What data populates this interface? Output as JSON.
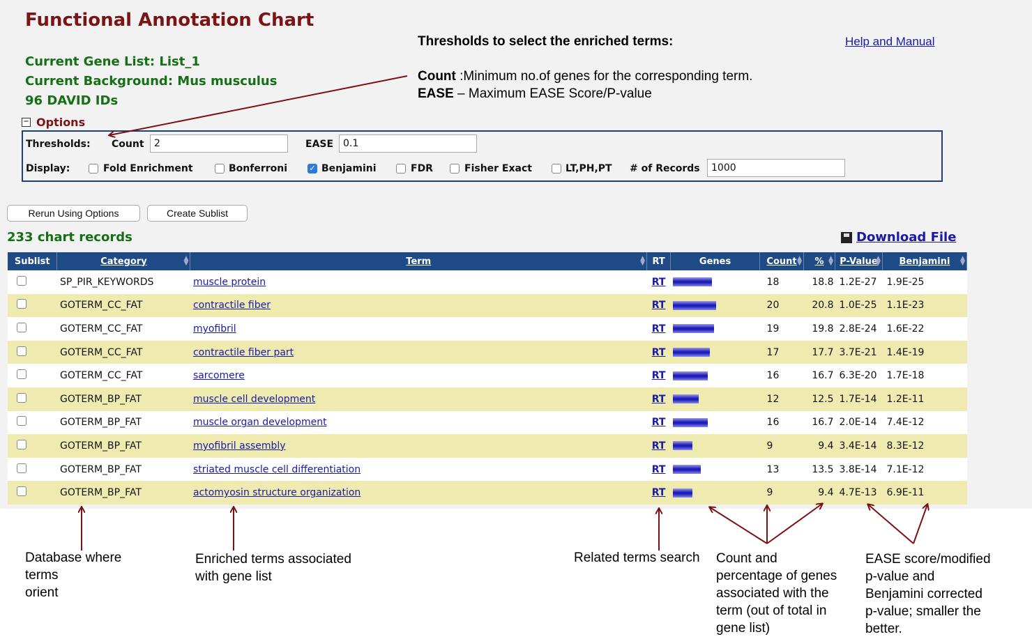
{
  "page": {
    "title": "Functional Annotation Chart",
    "gene_list": "Current Gene List: List_1",
    "background": "Current Background: Mus musculus",
    "ids": "96 DAVID IDs",
    "help_link": "Help and Manual"
  },
  "annotations": {
    "thresholds_heading": "Thresholds to select the enriched terms:",
    "count_label": "Count",
    "count_desc": " :Minimum no.of genes for the corresponding term.",
    "ease_label": "EASE",
    "ease_desc": " – Maximum EASE Score/P-value",
    "database": [
      "Database where",
      "terms",
      "orient"
    ],
    "enriched": [
      "Enriched terms associated",
      "with gene list"
    ],
    "related": "Related terms search",
    "count_pct": [
      "Count and",
      "percentage of genes",
      "associated with the",
      "term (out of total in",
      "gene list)"
    ],
    "ease_score": [
      "EASE score/modified",
      "p-value and",
      "Benjamini corrected",
      "p-value; smaller the",
      "better."
    ]
  },
  "options": {
    "header": "Options",
    "thresholds_label": "Thresholds:",
    "count_label": "Count",
    "count_value": "2",
    "ease_label": "EASE",
    "ease_value": "0.1",
    "display_label": "Display:",
    "checkboxes": [
      {
        "label": "Fold Enrichment",
        "checked": false
      },
      {
        "label": "Bonferroni",
        "checked": false
      },
      {
        "label": "Benjamini",
        "checked": true
      },
      {
        "label": "FDR",
        "checked": false
      },
      {
        "label": "Fisher Exact",
        "checked": false
      },
      {
        "label": "LT,PH,PT",
        "checked": false
      }
    ],
    "records_label": "# of Records",
    "records_value": "1000"
  },
  "buttons": {
    "rerun": "Rerun Using Options",
    "create_sublist": "Create Sublist"
  },
  "summary": {
    "records": "233 chart records",
    "download": "Download File"
  },
  "table": {
    "headers": {
      "sublist": "Sublist",
      "category": "Category",
      "term": "Term",
      "rt": "RT",
      "genes": "Genes",
      "count": "Count",
      "pct": "%",
      "pvalue": "P-Value",
      "benjamini": "Benjamini"
    },
    "rt_label": "RT",
    "rows": [
      {
        "category": "SP_PIR_KEYWORDS",
        "term": "muscle protein",
        "count": "18",
        "pct": "18.8",
        "pvalue": "1.2E-27",
        "benjamini": "1.9E-25"
      },
      {
        "category": "GOTERM_CC_FAT",
        "term": "contractile fiber",
        "count": "20",
        "pct": "20.8",
        "pvalue": "1.0E-25",
        "benjamini": "1.1E-23"
      },
      {
        "category": "GOTERM_CC_FAT",
        "term": "myofibril",
        "count": "19",
        "pct": "19.8",
        "pvalue": "2.8E-24",
        "benjamini": "1.6E-22"
      },
      {
        "category": "GOTERM_CC_FAT",
        "term": "contractile fiber part",
        "count": "17",
        "pct": "17.7",
        "pvalue": "3.7E-21",
        "benjamini": "1.4E-19"
      },
      {
        "category": "GOTERM_CC_FAT",
        "term": "sarcomere",
        "count": "16",
        "pct": "16.7",
        "pvalue": "6.3E-20",
        "benjamini": "1.7E-18"
      },
      {
        "category": "GOTERM_BP_FAT",
        "term": "muscle cell development",
        "count": "12",
        "pct": "12.5",
        "pvalue": "1.7E-14",
        "benjamini": "1.2E-11"
      },
      {
        "category": "GOTERM_BP_FAT",
        "term": "muscle organ development",
        "count": "16",
        "pct": "16.7",
        "pvalue": "2.0E-14",
        "benjamini": "7.4E-12"
      },
      {
        "category": "GOTERM_BP_FAT",
        "term": "myofibril assembly",
        "count": "9",
        "pct": "9.4",
        "pvalue": "3.4E-14",
        "benjamini": "8.3E-12"
      },
      {
        "category": "GOTERM_BP_FAT",
        "term": "striated muscle cell differentiation",
        "count": "13",
        "pct": "13.5",
        "pvalue": "3.8E-14",
        "benjamini": "7.1E-12"
      },
      {
        "category": "GOTERM_BP_FAT",
        "term": "actomyosin structure organization",
        "count": "9",
        "pct": "9.4",
        "pvalue": "4.7E-13",
        "benjamini": "6.9E-11"
      }
    ]
  }
}
